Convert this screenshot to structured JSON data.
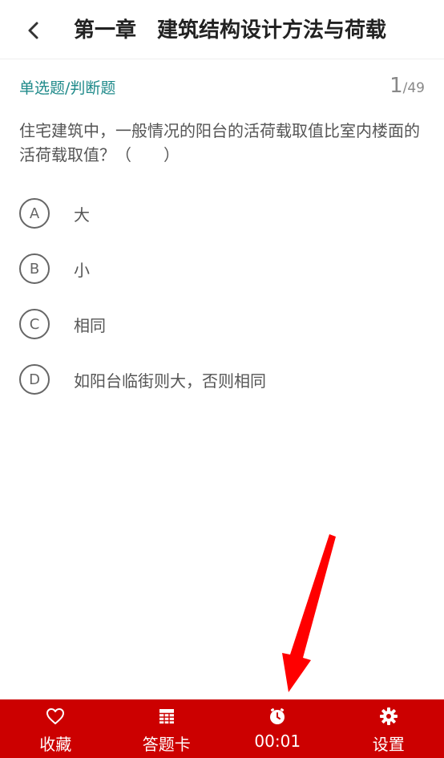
{
  "header": {
    "title": "第一章　建筑结构设计方法与荷载",
    "back_icon": "chevron-left-icon"
  },
  "question": {
    "type_label": "单选题/判断题",
    "current": "1",
    "total": "/49",
    "text": "住宅建筑中，一般情况的阳台的活荷载取值比室内楼面的活荷载取值？（　　）",
    "options": [
      {
        "letter": "A",
        "text": "大"
      },
      {
        "letter": "B",
        "text": "小"
      },
      {
        "letter": "C",
        "text": "相同"
      },
      {
        "letter": "D",
        "text": "如阳台临街则大，否则相同"
      }
    ]
  },
  "bottom_bar": {
    "color": "#cc0000",
    "items": [
      {
        "label": "收藏",
        "icon": "heart-icon"
      },
      {
        "label": "答题卡",
        "icon": "grid-icon"
      },
      {
        "label": "00:01",
        "icon": "clock-icon"
      },
      {
        "label": "设置",
        "icon": "gear-icon"
      }
    ]
  },
  "annotation": {
    "arrow_color": "#ff0000",
    "arrow_icon": "red-arrow-icon"
  }
}
